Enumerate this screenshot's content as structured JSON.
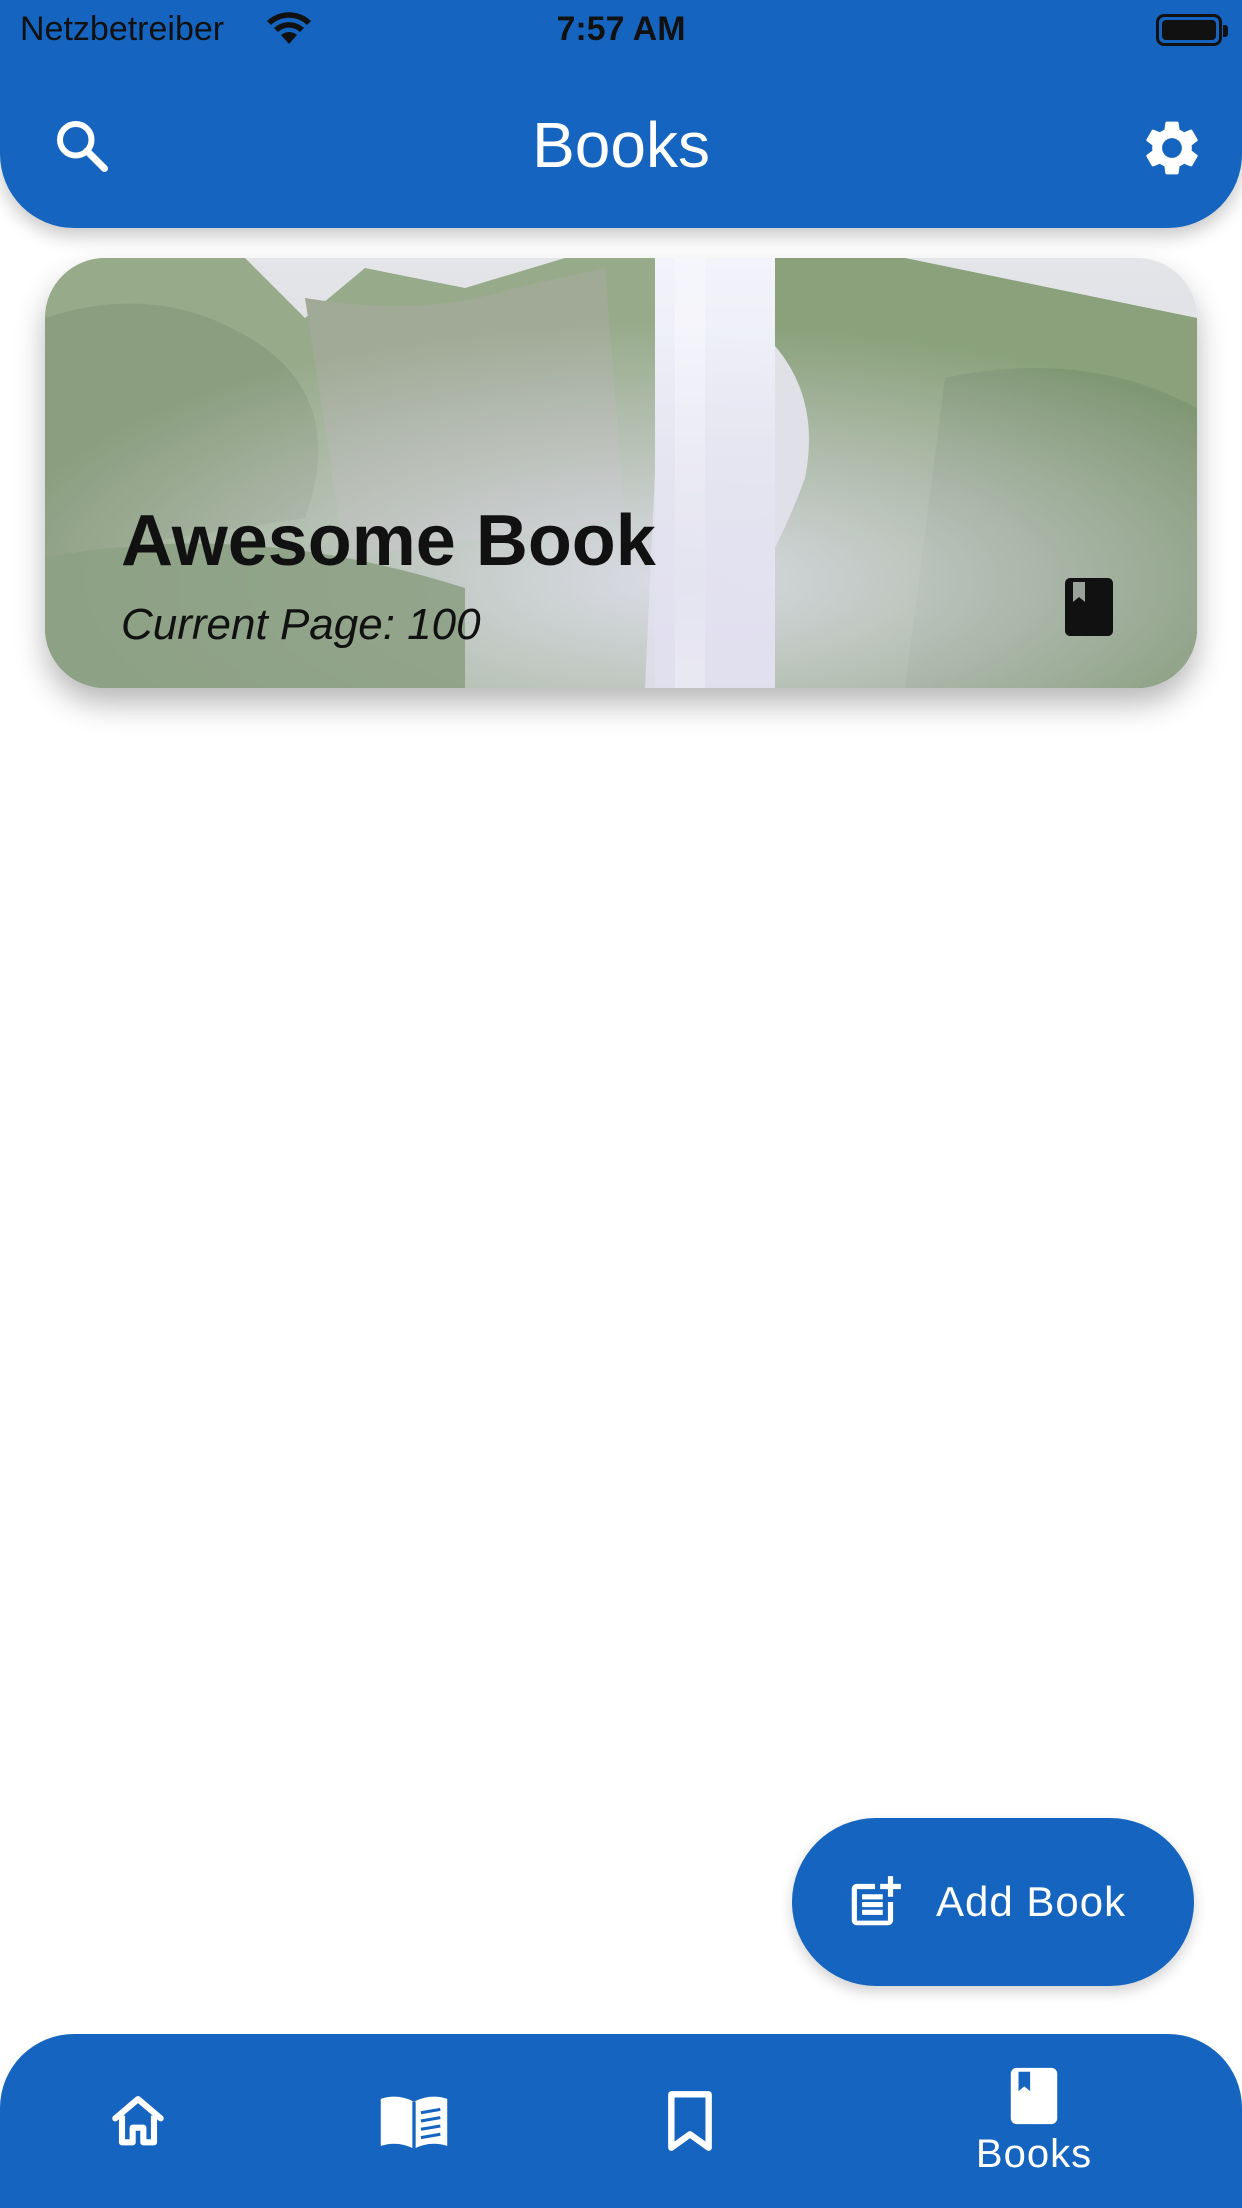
{
  "status_bar": {
    "carrier": "Netzbetreiber",
    "time": "7:57 AM"
  },
  "app_bar": {
    "title": "Books",
    "search_icon": "search-icon",
    "settings_icon": "gear-icon"
  },
  "books": [
    {
      "title": "Awesome Book",
      "current_page": "Current Page: 100",
      "icon": "book-icon"
    }
  ],
  "fab": {
    "label": "Add Book",
    "icon": "post-add-icon"
  },
  "bottom_nav": {
    "items": [
      {
        "icon": "home-icon",
        "label": ""
      },
      {
        "icon": "open-book-icon",
        "label": ""
      },
      {
        "icon": "bookmark-icon",
        "label": ""
      },
      {
        "icon": "book-icon",
        "label": "Books",
        "selected": true
      }
    ]
  },
  "colors": {
    "primary": "#1565C0",
    "on_primary": "#FFFFFF"
  }
}
